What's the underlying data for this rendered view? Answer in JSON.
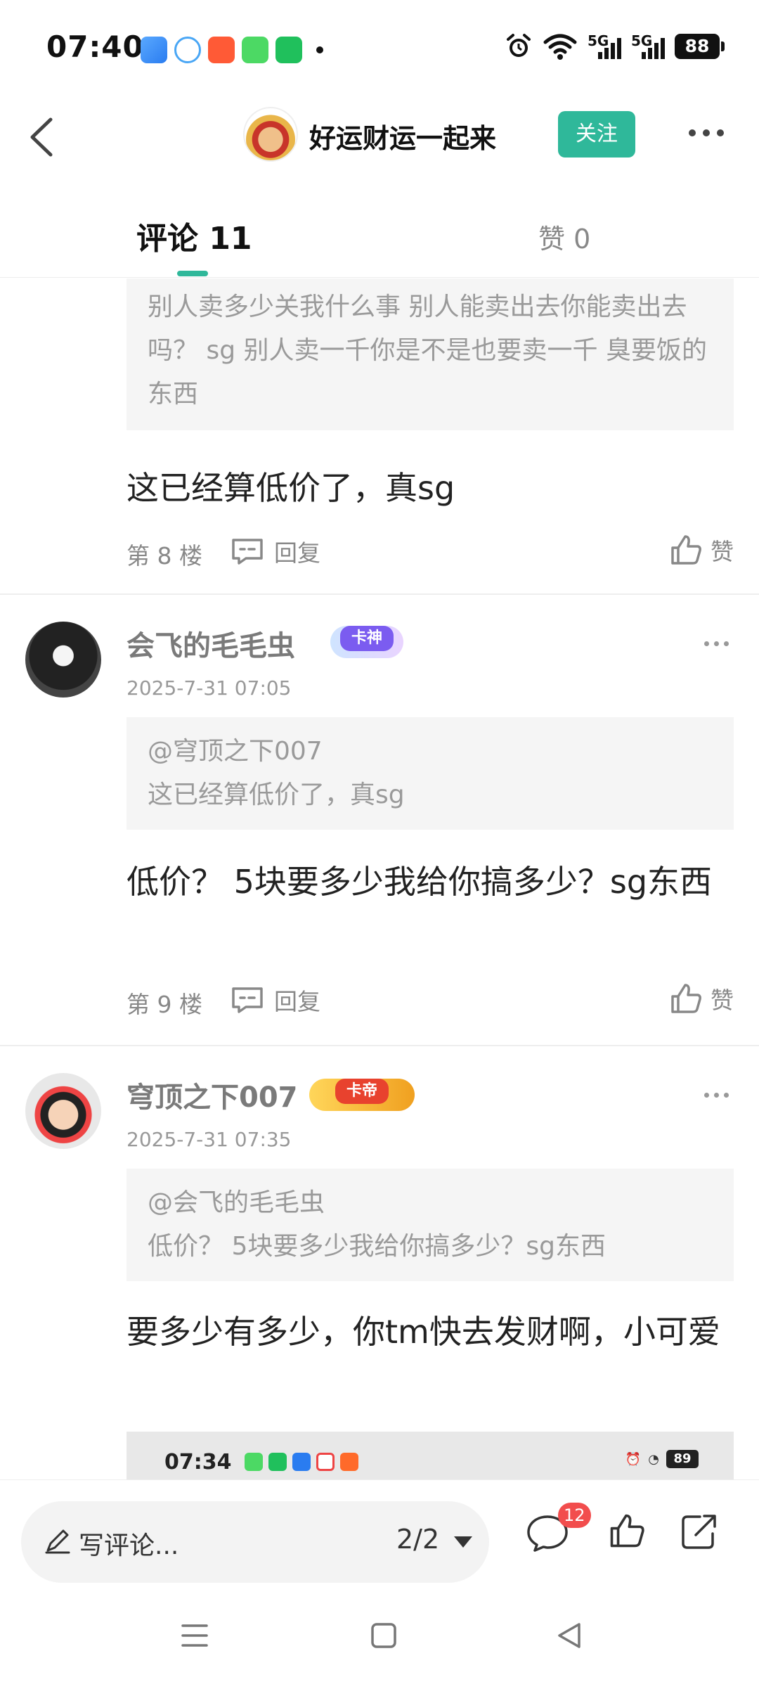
{
  "status_bar": {
    "time": "07:40",
    "network_1": "5G",
    "network_2": "5G",
    "battery": "88",
    "app_icons": [
      "weather-icon",
      "browser-icon",
      "video-app-icon",
      "message-icon",
      "iqiyi-icon"
    ],
    "icons": [
      "alarm-icon",
      "wifi-icon",
      "signal-icon",
      "battery-icon"
    ]
  },
  "header": {
    "back_icon": "chevron-left-icon",
    "owner_name": "好运财运一起来",
    "follow_label": "关注",
    "more_icon": "more-dots-icon"
  },
  "tabs": {
    "comments_label": "评论 11",
    "likes_label": "赞 0"
  },
  "posts": [
    {
      "quote_text": "别人卖多少关我什么事  别人能卖出去你能卖出去吗？ sg 别人卖一千你是不是也要卖一千 臭要饭的东西",
      "body": "这已经算低价了，真sg",
      "floor": "第 8 楼",
      "reply_label": "回复",
      "like_label": "赞"
    },
    {
      "user": "会飞的毛毛虫",
      "badge": "卡神",
      "time": "2025-7-31 07:05",
      "quote_at": "@穹顶之下007",
      "quote_text": "这已经算低价了，真sg",
      "body": "低价？  5块要多少我给你搞多少？sg东西",
      "floor": "第 9 楼",
      "reply_label": "回复",
      "like_label": "赞"
    },
    {
      "user": "穹顶之下007",
      "badge": "卡帝",
      "time": "2025-7-31 07:35",
      "quote_at": "@会飞的毛毛虫",
      "quote_text": "低价？  5块要多少我给你搞多少？sg东西",
      "body": "要多少有多少，你tm快去发财啊，小可爱",
      "embedded_time": "07:34",
      "embedded_battery": "89"
    }
  ],
  "bottom_bar": {
    "write_placeholder": "写评论...",
    "page_indicator": "2/2",
    "comment_count": "12",
    "icons": [
      "comment-icon",
      "like-icon",
      "share-icon"
    ]
  },
  "nav_bar": {
    "icons": [
      "menu-icon",
      "home-icon",
      "back-triangle-icon"
    ]
  },
  "colors": {
    "accent": "#2fb89a",
    "badge_red": "#f24d4d"
  }
}
